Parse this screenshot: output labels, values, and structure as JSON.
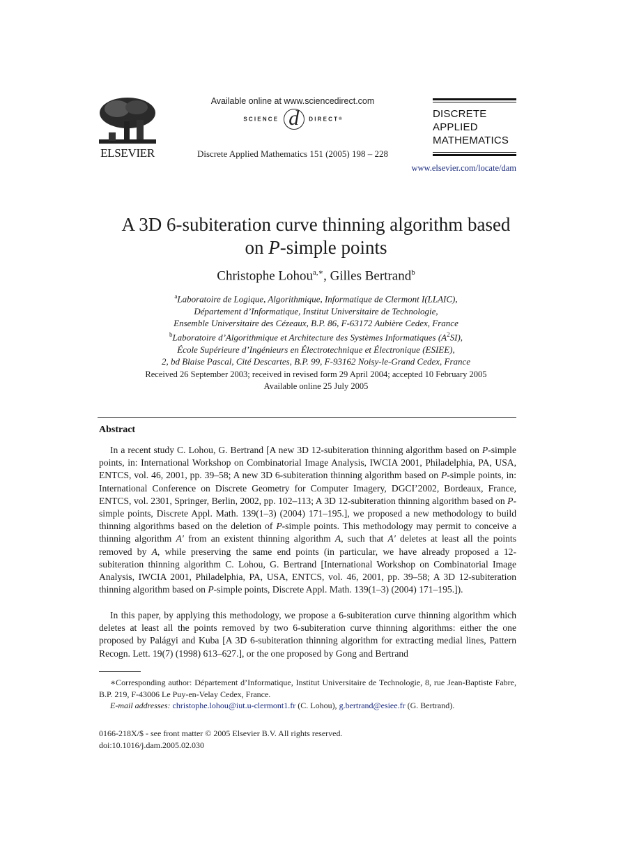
{
  "header": {
    "publisher_logo_text": "ELSEVIER",
    "available_online": "Available online at www.sciencedirect.com",
    "sciencedirect_left": "SCIENCE",
    "sciencedirect_mark": "d",
    "sciencedirect_right": "DIRECT",
    "sciencedirect_reg": "®",
    "journal_reference": "Discrete Applied Mathematics 151 (2005) 198 – 228",
    "journal_title_lines": [
      "DISCRETE",
      "APPLIED",
      "MATHEMATICS"
    ],
    "journal_url": "www.elsevier.com/locate/dam"
  },
  "article": {
    "title_line1": "A 3D 6-subiteration curve thinning algorithm based",
    "title_line2_pre": "on ",
    "title_line2_italic": "P",
    "title_line2_post": "-simple points",
    "authors": [
      {
        "name": "Christophe Lohou",
        "sup": "a,∗"
      },
      {
        "name": "Gilles Bertrand",
        "sup": "b"
      }
    ],
    "author_separator": ", ",
    "affiliations": [
      {
        "sup": "a",
        "lines": [
          "Laboratoire de Logique, Algorithmique, Informatique de Clermont I(LLAIC),",
          "Département d’Informatique, Institut Universitaire de Technologie,",
          "Ensemble Universitaire des Cézeaux, B.P. 86, F-63172 Aubière Cedex, France"
        ]
      },
      {
        "sup": "b",
        "line1_pre": "Laboratoire d’Algorithmique et Architecture des Systèmes Informatiques (A",
        "line1_sup": "2",
        "line1_post": "SI),",
        "lines": [
          "École Supérieure d’Ingénieurs en Électrotechnique et Électronique (ESIEE),",
          "2, bd Blaise Pascal, Cité Descartes, B.P. 99, F-93162 Noisy-le-Grand Cedex, France"
        ]
      }
    ],
    "received": "Received 26 September 2003; received in revised form 29 April 2004; accepted 10 February 2005",
    "available_online": "Available online 25 July 2005"
  },
  "abstract": {
    "heading": "Abstract",
    "p1": [
      {
        "t": "In a recent study C. Lohou, G. Bertrand [A new 3D 12-subiteration thinning algorithm based on "
      },
      {
        "i": "P"
      },
      {
        "t": "-simple points, in: International Workshop on Combinatorial Image Analysis, IWCIA 2001, Philadelphia, PA, USA, ENTCS, vol. 46, 2001, pp. 39–58; A new 3D 6-subiteration thinning algorithm based on "
      },
      {
        "i": "P"
      },
      {
        "t": "-simple points, in: International Conference on Discrete Geometry for Computer Imagery, DGCI’2002, Bordeaux, France, ENTCS, vol. 2301, Springer, Berlin, 2002, pp. 102–113; A 3D 12-subiteration thinning algorithm based on "
      },
      {
        "i": "P"
      },
      {
        "t": "-simple points, Discrete Appl. Math. 139(1–3) (2004) 171–195.], we proposed a new methodology to build thinning algorithms based on the deletion of "
      },
      {
        "i": "P"
      },
      {
        "t": "-simple points. This methodology may permit to conceive a thinning algorithm "
      },
      {
        "i": "A′"
      },
      {
        "t": " from an existent thinning algorithm "
      },
      {
        "i": "A"
      },
      {
        "t": ", such that "
      },
      {
        "i": "A′"
      },
      {
        "t": " deletes at least all the points removed by "
      },
      {
        "i": "A"
      },
      {
        "t": ", while preserving the same end points (in particular, we have already proposed a 12-subiteration thinning algorithm C. Lohou, G. Bertrand [International Workshop on Combinatorial Image Analysis, IWCIA 2001, Philadelphia, PA, USA, ENTCS, vol. 46, 2001, pp. 39–58; A 3D 12-subiteration thinning algorithm based on "
      },
      {
        "i": "P"
      },
      {
        "t": "-simple points, Discrete Appl. Math. 139(1–3) (2004) 171–195.])."
      }
    ],
    "p2": [
      {
        "t": "In this paper, by applying this methodology, we propose a 6-subiteration curve thinning algorithm which deletes at least all the points removed by two 6-subiteration curve thinning algorithms: either the one proposed by Palágyi and Kuba [A 3D 6-subiteration thinning algorithm for extracting medial lines, Pattern Recogn. Lett. 19(7) (1998) 613–627.], or the one proposed by Gong and Bertrand"
      }
    ]
  },
  "footnotes": {
    "corresponding_mark": "∗",
    "corresponding_text": "Corresponding author: Département d’Informatique, Institut Universitaire de Technologie, 8, rue Jean-Baptiste Fabre, B.P. 219, F-43006 Le Puy-en-Velay Cedex, France.",
    "email_label": "E-mail addresses:",
    "email1": "christophe.lohou@iut.u-clermont1.fr",
    "email1_owner": " (C. Lohou), ",
    "email2": "g.bertrand@esiee.fr",
    "email2_owner": " (G. Bertrand)."
  },
  "copyright": {
    "line1": "0166-218X/$ - see front matter © 2005 Elsevier B.V. All rights reserved.",
    "doi": "doi:10.1016/j.dam.2005.02.030"
  }
}
